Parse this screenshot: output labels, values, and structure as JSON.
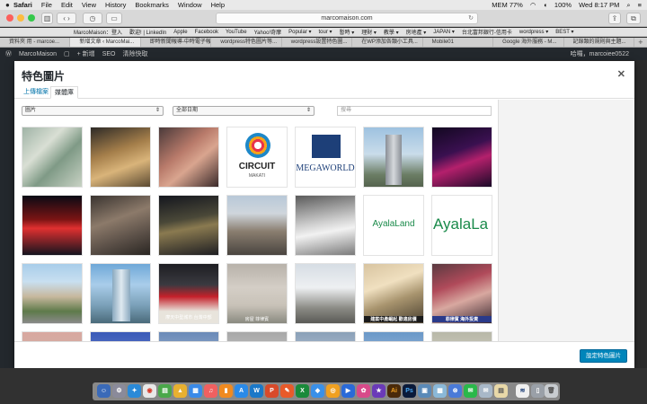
{
  "menubar": {
    "items": [
      "Safari",
      "File",
      "Edit",
      "View",
      "History",
      "Bookmarks",
      "Window",
      "Help"
    ],
    "status_mem": "MEM 77%",
    "battery": "100%",
    "clock": "Wed 8:17 PM"
  },
  "browser": {
    "url": "marcomaison.com",
    "bookmarks": [
      "MarcoMaison：登入",
      "歡迎! | LinkedIn",
      "Apple",
      "Facebook",
      "YouTube",
      "Yahoo!奇摩",
      "Popular ▾",
      "tour ▾",
      "暫時 ▾",
      "理財 ▾",
      "教學 ▾",
      "房地產 ▾",
      "JAPAN ▾",
      "台北富邦銀行-信用卡",
      "wordpress ▾",
      "BEST ▾"
    ],
    "tabs": [
      "資料夾 用 - marcoe...",
      "新增文章 ‹ MarcoMai...",
      "即時新聞報導-中時電子報",
      "wordpress特色圖片等...",
      "wordpress設置特色圖...",
      "在WP添加各類小工具...",
      "Mobile01",
      "Google 海外服務 - M...",
      "記錄類的規則與主題..."
    ]
  },
  "wpbar": {
    "site": "MarcoMaison",
    "new": "+ 新增",
    "seo": "SEO",
    "cache": "清除快取",
    "user": "哈囉，marcoiee0522"
  },
  "modal": {
    "title": "特色圖片",
    "tab_upload": "上傳檔案",
    "tab_library": "媒體庫",
    "filter_type": "圖片",
    "filter_date": "全部日期",
    "search_placeholder": "搜尋",
    "set_button": "設定特色圖片",
    "captions": {
      "circuit": "CIRCUIT",
      "circuit_sub": "MAKATI",
      "megaworld": "MEGAWORLD",
      "ayala1": "AyalaLand",
      "ayala2": "AyalaLa",
      "news1": "摩天中型城市 台灣中部",
      "news2": "建案中產崛起 歡適房價",
      "news3": "菲律賓 海外投資",
      "news4": "房屋 菲律賓"
    }
  }
}
